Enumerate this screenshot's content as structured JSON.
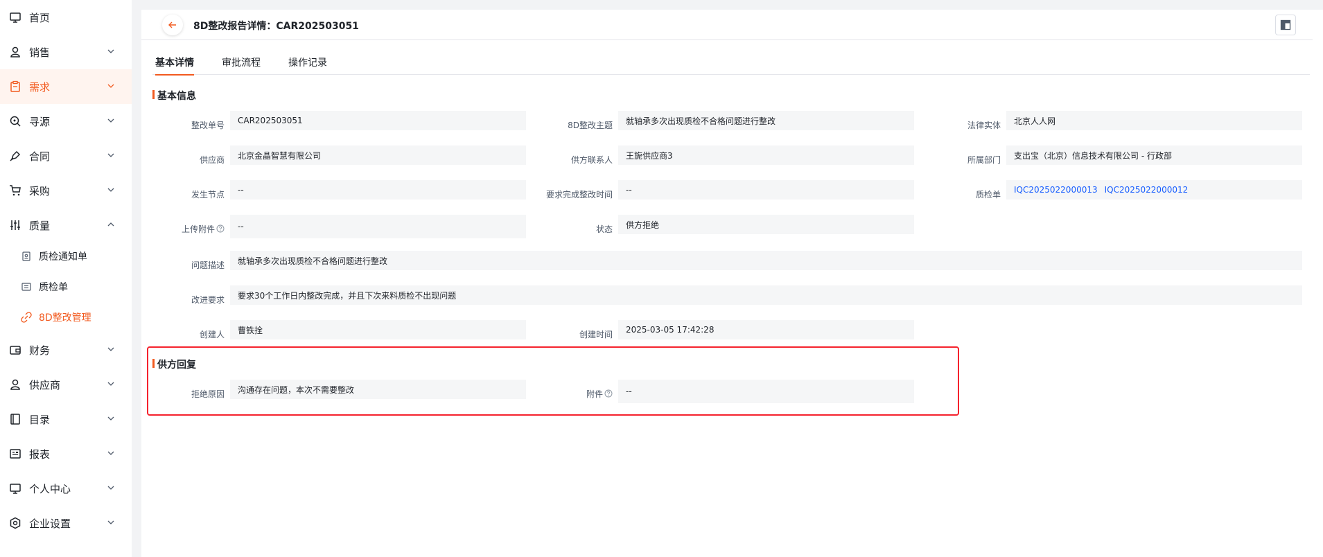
{
  "sidebar": {
    "items": [
      {
        "label": "首页",
        "icon": "monitor-icon"
      },
      {
        "label": "销售",
        "icon": "user-icon"
      },
      {
        "label": "需求",
        "icon": "clipboard-icon"
      },
      {
        "label": "寻源",
        "icon": "search-icon"
      },
      {
        "label": "合同",
        "icon": "pen-icon"
      },
      {
        "label": "采购",
        "icon": "cart-icon"
      },
      {
        "label": "质量",
        "icon": "sliders-icon"
      },
      {
        "label": "财务",
        "icon": "wallet-icon"
      },
      {
        "label": "供应商",
        "icon": "user-icon"
      },
      {
        "label": "目录",
        "icon": "book-icon"
      },
      {
        "label": "报表",
        "icon": "report-icon"
      },
      {
        "label": "个人中心",
        "icon": "monitor-icon"
      },
      {
        "label": "企业设置",
        "icon": "gear-icon"
      }
    ],
    "quality_sub": [
      {
        "label": "质检通知单",
        "icon": "doc-icon"
      },
      {
        "label": "质检单",
        "icon": "list-icon"
      },
      {
        "label": "8D整改管理",
        "icon": "link-icon"
      }
    ]
  },
  "header": {
    "title": "8D整改报告详情：CAR202503051"
  },
  "tabs": [
    "基本详情",
    "审批流程",
    "操作记录"
  ],
  "basic": {
    "section_title": "基本信息",
    "fields": {
      "car_no": {
        "label": "整改单号",
        "value": "CAR202503051"
      },
      "subject": {
        "label": "8D整改主题",
        "value": "就轴承多次出现质检不合格问题进行整改"
      },
      "legal_entity": {
        "label": "法律实体",
        "value": "北京人人网"
      },
      "supplier": {
        "label": "供应商",
        "value": "北京金晶智慧有限公司"
      },
      "supplier_contact": {
        "label": "供方联系人",
        "value": "王旎供应商3"
      },
      "department": {
        "label": "所属部门",
        "value": "支出宝（北京）信息技术有限公司 - 行政部"
      },
      "node": {
        "label": "发生节点",
        "value": "--"
      },
      "deadline": {
        "label": "要求完成整改时间",
        "value": "--"
      },
      "inspection": {
        "label": "质检单",
        "links": [
          "IQC2025022000013",
          "IQC2025022000012"
        ]
      },
      "attachment": {
        "label": "上传附件",
        "value": "--"
      },
      "status": {
        "label": "状态",
        "value": "供方拒绝"
      },
      "description": {
        "label": "问题描述",
        "value": "就轴承多次出现质检不合格问题进行整改"
      },
      "requirement": {
        "label": "改进要求",
        "value": "要求30个工作日内整改完成，并且下次来料质检不出现问题"
      },
      "creator": {
        "label": "创建人",
        "value": "曹铁拴"
      },
      "created_at": {
        "label": "创建时间",
        "value": "2025-03-05 17:42:28"
      }
    }
  },
  "reply": {
    "section_title": "供方回复",
    "reason": {
      "label": "拒绝原因",
      "value": "沟通存在问题，本次不需要整改"
    },
    "attachment": {
      "label": "附件",
      "value": "--"
    }
  },
  "colors": {
    "accent": "#f25a1f",
    "link": "#165dff",
    "highlight": "#f5222d"
  }
}
